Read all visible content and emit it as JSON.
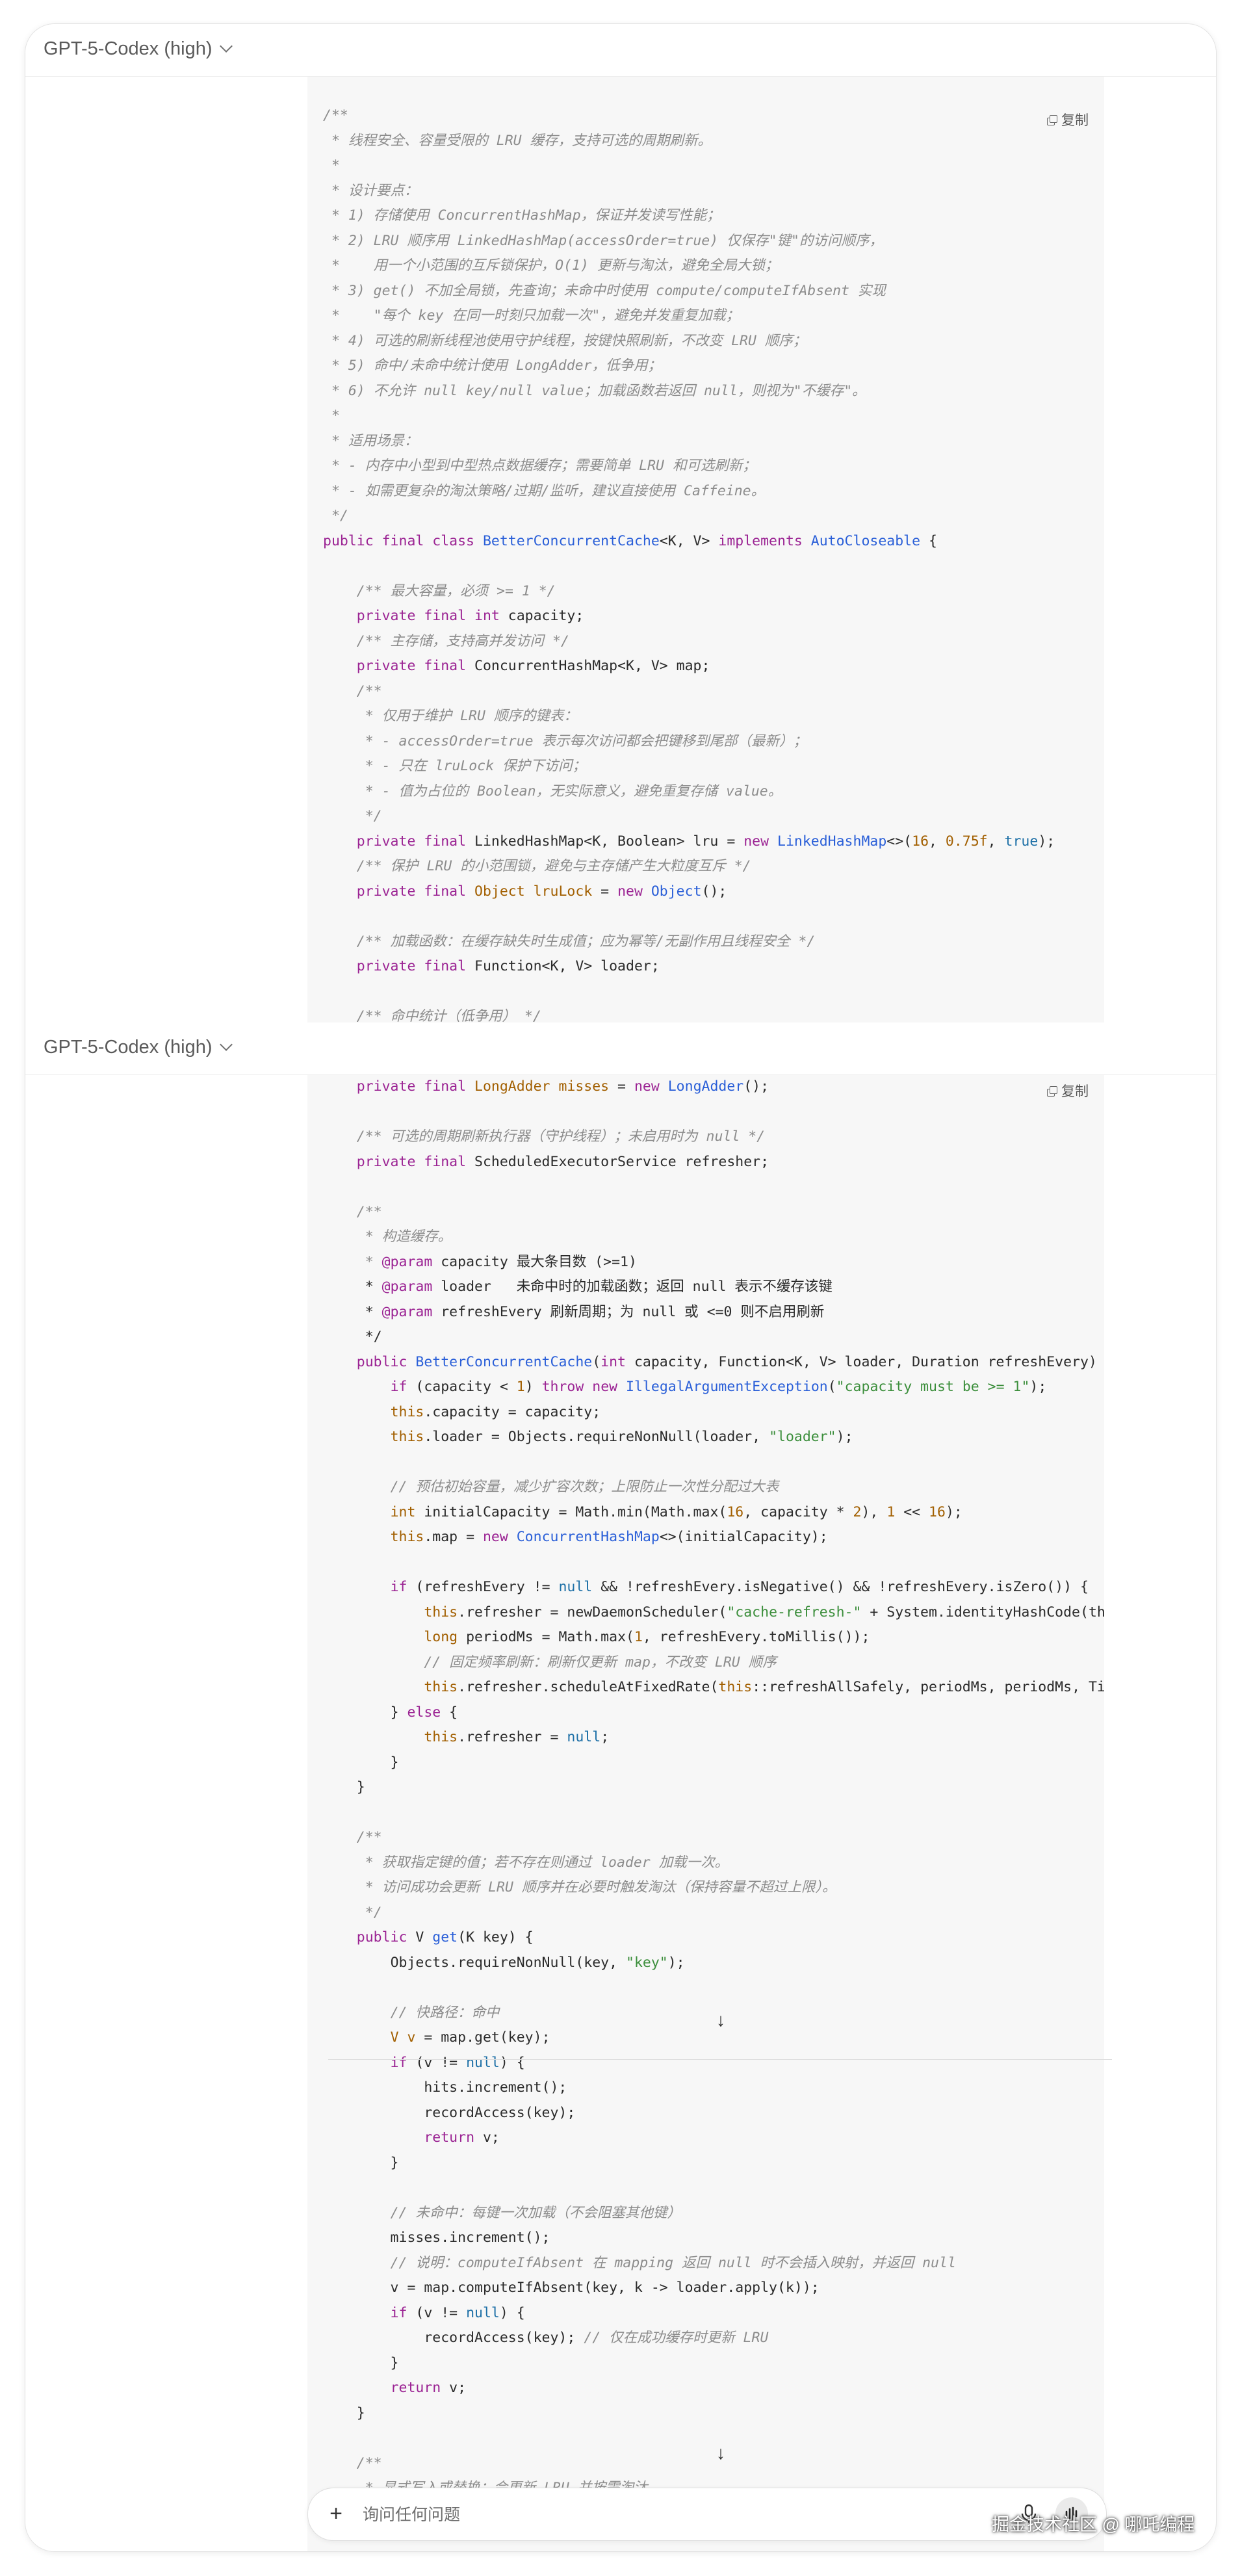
{
  "header": {
    "model": "GPT-5-Codex (high)"
  },
  "copy_label": "复制",
  "panel1_lines": [
    [
      [
        "/**",
        "c"
      ]
    ],
    [
      [
        " * 线程安全、容量受限的 LRU 缓存，支持可选的周期刷新。",
        "c"
      ]
    ],
    [
      [
        " *",
        "c"
      ]
    ],
    [
      [
        " * 设计要点：",
        "c"
      ]
    ],
    [
      [
        " * 1) 存储使用 ConcurrentHashMap，保证并发读写性能；",
        "c"
      ]
    ],
    [
      [
        " * 2) LRU 顺序用 LinkedHashMap(accessOrder=true) 仅保存\"键\"的访问顺序，",
        "c"
      ]
    ],
    [
      [
        " *    用一个小范围的互斥锁保护，O(1) 更新与淘汰，避免全局大锁；",
        "c"
      ]
    ],
    [
      [
        " * 3) get() 不加全局锁，先查询；未命中时使用 compute/computeIfAbsent 实现",
        "c"
      ]
    ],
    [
      [
        " *    \"每个 key 在同一时刻只加载一次\"，避免并发重复加载；",
        "c"
      ]
    ],
    [
      [
        " * 4) 可选的刷新线程池使用守护线程，按键快照刷新，不改变 LRU 顺序；",
        "c"
      ]
    ],
    [
      [
        " * 5) 命中/未命中统计使用 LongAdder，低争用；",
        "c"
      ]
    ],
    [
      [
        " * 6) 不允许 null key/null value；加载函数若返回 null，则视为\"不缓存\"。",
        "c"
      ]
    ],
    [
      [
        " *",
        "c"
      ]
    ],
    [
      [
        " * 适用场景：",
        "c"
      ]
    ],
    [
      [
        " * - 内存中小型到中型热点数据缓存；需要简单 LRU 和可选刷新；",
        "c"
      ]
    ],
    [
      [
        " * - 如需更复杂的淘汰策略/过期/监听，建议直接使用 Caffeine。",
        "c"
      ]
    ],
    [
      [
        " */",
        "c"
      ]
    ],
    [
      [
        "public final class ",
        "k"
      ],
      [
        "BetterConcurrentCache",
        "t"
      ],
      [
        "<K, V> ",
        ""
      ],
      [
        "implements ",
        "k"
      ],
      [
        "AutoCloseable",
        "t"
      ],
      [
        " {",
        ""
      ]
    ],
    [],
    [
      [
        "    ",
        ""
      ],
      [
        "/** 最大容量，必须 >= 1 */",
        "c"
      ]
    ],
    [
      [
        "    ",
        ""
      ],
      [
        "private final int ",
        "k"
      ],
      [
        "capacity;",
        ""
      ]
    ],
    [
      [
        "    ",
        ""
      ],
      [
        "/** 主存储，支持高并发访问 */",
        "c"
      ]
    ],
    [
      [
        "    ",
        ""
      ],
      [
        "private final ",
        "k"
      ],
      [
        "ConcurrentHashMap<K, V> map;",
        ""
      ]
    ],
    [
      [
        "    ",
        ""
      ],
      [
        "/**",
        "c"
      ]
    ],
    [
      [
        "    ",
        ""
      ],
      [
        " * 仅用于维护 LRU 顺序的键表：",
        "c"
      ]
    ],
    [
      [
        "    ",
        ""
      ],
      [
        " * - accessOrder=true 表示每次访问都会把键移到尾部（最新）；",
        "c"
      ]
    ],
    [
      [
        "    ",
        ""
      ],
      [
        " * - 只在 lruLock 保护下访问；",
        "c"
      ]
    ],
    [
      [
        "    ",
        ""
      ],
      [
        " * - 值为占位的 Boolean，无实际意义，避免重复存储 value。",
        "c"
      ]
    ],
    [
      [
        "    ",
        ""
      ],
      [
        " */",
        "c"
      ]
    ],
    [
      [
        "    ",
        ""
      ],
      [
        "private final ",
        "k"
      ],
      [
        "LinkedHashMap<K, Boolean> lru = ",
        ""
      ],
      [
        "new ",
        "k"
      ],
      [
        "LinkedHashMap",
        "t"
      ],
      [
        "<>(",
        ""
      ],
      [
        "16",
        "a"
      ],
      [
        ", ",
        ""
      ],
      [
        "0.75f",
        "a"
      ],
      [
        ", ",
        ""
      ],
      [
        "true",
        "n"
      ],
      [
        ");",
        ""
      ]
    ],
    [
      [
        "    ",
        ""
      ],
      [
        "/** 保护 LRU 的小范围锁，避免与主存储产生大粒度互斥 */",
        "c"
      ]
    ],
    [
      [
        "    ",
        ""
      ],
      [
        "private final ",
        "k"
      ],
      [
        "Object lruLock",
        "a"
      ],
      [
        " = ",
        ""
      ],
      [
        "new ",
        "k"
      ],
      [
        "Object",
        "t"
      ],
      [
        "();",
        ""
      ]
    ],
    [],
    [
      [
        "    ",
        ""
      ],
      [
        "/** 加载函数：在缓存缺失时生成值；应为幂等/无副作用且线程安全 */",
        "c"
      ]
    ],
    [
      [
        "    ",
        ""
      ],
      [
        "private final ",
        "k"
      ],
      [
        "Function<K, V> loader;",
        ""
      ]
    ],
    [],
    [
      [
        "    ",
        ""
      ],
      [
        "/** 命中统计（低争用） */",
        "c"
      ]
    ]
  ],
  "panel2_lines": [
    [
      [
        "    ",
        ""
      ],
      [
        "private final ",
        "k"
      ],
      [
        "LongAdder misses",
        "a"
      ],
      [
        " = ",
        ""
      ],
      [
        "new ",
        "k"
      ],
      [
        "LongAdder",
        "t"
      ],
      [
        "();",
        ""
      ]
    ],
    [],
    [
      [
        "    ",
        ""
      ],
      [
        "/** 可选的周期刷新执行器（守护线程）；未启用时为 null */",
        "c"
      ]
    ],
    [
      [
        "    ",
        ""
      ],
      [
        "private final ",
        "k"
      ],
      [
        "ScheduledExecutorService refresher;",
        ""
      ]
    ],
    [],
    [
      [
        "    ",
        ""
      ],
      [
        "/**",
        "c"
      ]
    ],
    [
      [
        "    ",
        ""
      ],
      [
        " * 构造缓存。",
        "c"
      ]
    ],
    [
      [
        "    ",
        ""
      ],
      [
        " * ",
        "c"
      ],
      [
        "@param",
        "p"
      ],
      [
        " capacity 最大条目数 (>=1)",
        ""
      ]
    ],
    [
      [
        "    ",
        ""
      ],
      [
        " * ",
        ""
      ],
      [
        "@param",
        "p"
      ],
      [
        " loader   未命中时的加载函数；返回 null 表示不缓存该键",
        ""
      ]
    ],
    [
      [
        "    ",
        ""
      ],
      [
        " * ",
        ""
      ],
      [
        "@param",
        "p"
      ],
      [
        " refreshEvery 刷新周期；为 null 或 <=0 则不启用刷新",
        ""
      ]
    ],
    [
      [
        "    ",
        ""
      ],
      [
        " */",
        ""
      ]
    ],
    [
      [
        "    ",
        ""
      ],
      [
        "public ",
        "k"
      ],
      [
        "BetterConcurrentCache",
        "t"
      ],
      [
        "(",
        ""
      ],
      [
        "int ",
        "k"
      ],
      [
        "capacity, Function<K, V> loader, Duration refreshEvery) {",
        ""
      ]
    ],
    [
      [
        "        ",
        ""
      ],
      [
        "if ",
        "k"
      ],
      [
        "(capacity < ",
        ""
      ],
      [
        "1",
        "a"
      ],
      [
        ") ",
        ""
      ],
      [
        "throw new ",
        "k"
      ],
      [
        "IllegalArgumentException",
        "t"
      ],
      [
        "(",
        ""
      ],
      [
        "\"capacity must be >= 1\"",
        "s"
      ],
      [
        ");",
        ""
      ]
    ],
    [
      [
        "        ",
        ""
      ],
      [
        "this",
        "a"
      ],
      [
        ".capacity = capacity;",
        ""
      ]
    ],
    [
      [
        "        ",
        ""
      ],
      [
        "this",
        "a"
      ],
      [
        ".loader = Objects.requireNonNull(loader, ",
        ""
      ],
      [
        "\"loader\"",
        "s"
      ],
      [
        ");",
        ""
      ]
    ],
    [],
    [
      [
        "        ",
        ""
      ],
      [
        "// 预估初始容量，减少扩容次数；上限防止一次性分配过大表",
        "c"
      ]
    ],
    [
      [
        "        ",
        ""
      ],
      [
        "int ",
        "a"
      ],
      [
        "initialCapacity = Math.min(Math.max(",
        ""
      ],
      [
        "16",
        "a"
      ],
      [
        ", capacity * ",
        ""
      ],
      [
        "2",
        "a"
      ],
      [
        "), ",
        ""
      ],
      [
        "1",
        "a"
      ],
      [
        " << ",
        ""
      ],
      [
        "16",
        "a"
      ],
      [
        ");",
        ""
      ]
    ],
    [
      [
        "        ",
        ""
      ],
      [
        "this",
        "a"
      ],
      [
        ".map = ",
        ""
      ],
      [
        "new ",
        "k"
      ],
      [
        "ConcurrentHashMap",
        "t"
      ],
      [
        "<>(initialCapacity);",
        ""
      ]
    ],
    [],
    [
      [
        "        ",
        ""
      ],
      [
        "if ",
        "k"
      ],
      [
        "(refreshEvery != ",
        ""
      ],
      [
        "null",
        "n"
      ],
      [
        " && !refreshEvery.isNegative() && !refreshEvery.isZero()) {",
        ""
      ]
    ],
    [
      [
        "            ",
        ""
      ],
      [
        "this",
        "a"
      ],
      [
        ".refresher = newDaemonScheduler(",
        ""
      ],
      [
        "\"cache-refresh-\"",
        "s"
      ],
      [
        " + System.identityHashCode(this));",
        ""
      ]
    ],
    [
      [
        "            ",
        ""
      ],
      [
        "long ",
        "a"
      ],
      [
        "periodMs = Math.max(",
        ""
      ],
      [
        "1",
        "a"
      ],
      [
        ", refreshEvery.toMillis());",
        ""
      ]
    ],
    [
      [
        "            ",
        ""
      ],
      [
        "// 固定频率刷新：刷新仅更新 map，不改变 LRU 顺序",
        "c"
      ]
    ],
    [
      [
        "            ",
        ""
      ],
      [
        "this",
        "a"
      ],
      [
        ".refresher.scheduleAtFixedRate(",
        ""
      ],
      [
        "this",
        "a"
      ],
      [
        "::refreshAllSafely, periodMs, periodMs, TimeUnit.MILLISECONDS);",
        ""
      ]
    ],
    [
      [
        "        ",
        ""
      ],
      [
        "} ",
        ""
      ],
      [
        "else",
        "k"
      ],
      [
        " {",
        ""
      ]
    ],
    [
      [
        "            ",
        ""
      ],
      [
        "this",
        "a"
      ],
      [
        ".refresher = ",
        ""
      ],
      [
        "null",
        "n"
      ],
      [
        ";",
        ""
      ]
    ],
    [
      [
        "        }",
        ""
      ]
    ],
    [
      [
        "    }",
        ""
      ]
    ],
    [],
    [
      [
        "    ",
        ""
      ],
      [
        "/**",
        "c"
      ]
    ],
    [
      [
        "    ",
        ""
      ],
      [
        " * 获取指定键的值；若不存在则通过 loader 加载一次。",
        "c"
      ]
    ],
    [
      [
        "    ",
        ""
      ],
      [
        " * 访问成功会更新 LRU 顺序并在必要时触发淘汰（保持容量不超过上限）。",
        "c"
      ]
    ],
    [
      [
        "    ",
        ""
      ],
      [
        " */",
        "c"
      ]
    ],
    [
      [
        "    ",
        ""
      ],
      [
        "public ",
        "k"
      ],
      [
        "V ",
        ""
      ],
      [
        "get",
        "t"
      ],
      [
        "(K key) {",
        ""
      ]
    ],
    [
      [
        "        ",
        ""
      ],
      [
        "Objects.requireNonNull(key, ",
        ""
      ],
      [
        "\"key\"",
        "s"
      ],
      [
        ");",
        ""
      ]
    ],
    [],
    [
      [
        "        ",
        ""
      ],
      [
        "// 快路径：命中",
        "c"
      ]
    ],
    [
      [
        "        ",
        ""
      ],
      [
        "V v",
        "a"
      ],
      [
        " = map.get(key);",
        ""
      ]
    ],
    [
      [
        "        ",
        ""
      ],
      [
        "if ",
        "k"
      ],
      [
        "(v != ",
        ""
      ],
      [
        "null",
        "n"
      ],
      [
        ") {",
        ""
      ]
    ],
    [
      [
        "            hits.increment();",
        ""
      ]
    ],
    [
      [
        "            recordAccess(key);",
        ""
      ]
    ],
    [
      [
        "            ",
        ""
      ],
      [
        "return ",
        "k"
      ],
      [
        "v;",
        ""
      ]
    ],
    [
      [
        "        }",
        ""
      ]
    ],
    [],
    [
      [
        "        ",
        ""
      ],
      [
        "// 未命中：每键一次加载（不会阻塞其他键）",
        "c"
      ]
    ],
    [
      [
        "        misses.increment();",
        ""
      ]
    ],
    [
      [
        "        ",
        ""
      ],
      [
        "// 说明：computeIfAbsent 在 mapping 返回 null 时不会插入映射，并返回 null",
        "c"
      ]
    ],
    [
      [
        "        v = map.computeIfAbsent(key, k -> loader.apply(k));",
        ""
      ]
    ],
    [
      [
        "        ",
        ""
      ],
      [
        "if ",
        "k"
      ],
      [
        "(v != ",
        ""
      ],
      [
        "null",
        "n"
      ],
      [
        ") {",
        ""
      ]
    ],
    [
      [
        "            recordAccess(key); ",
        ""
      ],
      [
        "// 仅在成功缓存时更新 LRU",
        "c"
      ]
    ],
    [
      [
        "        }",
        ""
      ]
    ],
    [
      [
        "        ",
        ""
      ],
      [
        "return ",
        "k"
      ],
      [
        "v;",
        ""
      ]
    ],
    [
      [
        "    }",
        ""
      ]
    ],
    [],
    [
      [
        "    ",
        ""
      ],
      [
        "/**",
        "c"
      ]
    ],
    [
      [
        "    ",
        ""
      ],
      [
        " * 显式写入或替换；会更新 LRU 并按需淘汰。",
        "c"
      ]
    ],
    [
      [
        "    ",
        ""
      ],
      [
        " */",
        "c"
      ]
    ]
  ],
  "composer": {
    "placeholder": "询问任何问题"
  },
  "watermark": "掘金技术社区 @ 哪吒编程"
}
